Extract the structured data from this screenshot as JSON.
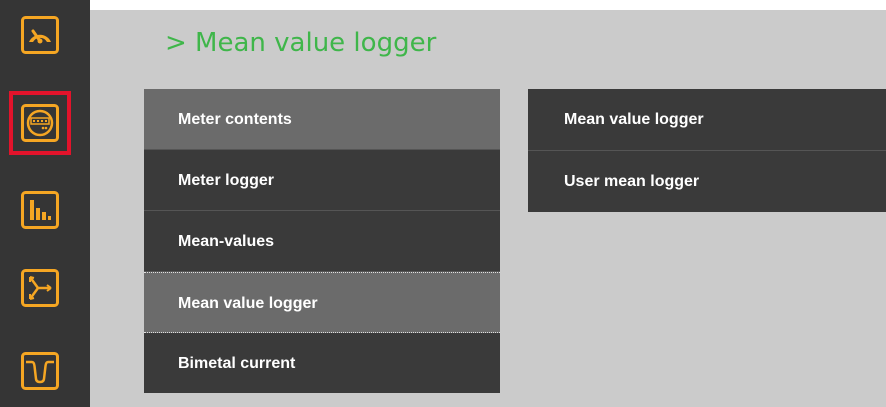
{
  "sidebar": {
    "items": [
      {
        "icon": "gauge-icon"
      },
      {
        "icon": "meter-icon",
        "active": true
      },
      {
        "icon": "bar-chart-icon"
      },
      {
        "icon": "three-phase-icon"
      },
      {
        "icon": "waveform-icon"
      }
    ],
    "accent_color": "#f5a623",
    "active_border_color": "#e3132b"
  },
  "header": {
    "title": "> Mean value logger",
    "title_color": "#3fb64a"
  },
  "menu": {
    "items": [
      {
        "label": "Meter contents"
      },
      {
        "label": "Meter logger"
      },
      {
        "label": "Mean-values"
      },
      {
        "label": "Mean value logger"
      },
      {
        "label": "Bimetal current"
      }
    ]
  },
  "submenu": {
    "items": [
      {
        "label": "Mean value logger"
      },
      {
        "label": "User mean logger"
      }
    ]
  }
}
